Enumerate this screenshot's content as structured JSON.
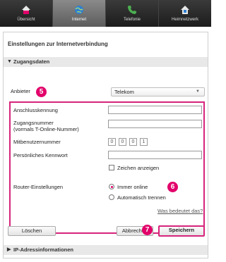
{
  "nav": {
    "tabs": [
      {
        "label": "Übersicht",
        "icon": "home-icon"
      },
      {
        "label": "Internet",
        "icon": "globe-icon"
      },
      {
        "label": "Telefonie",
        "icon": "phone-icon"
      },
      {
        "label": "Heimnetzwerk",
        "icon": "house-network-icon"
      }
    ],
    "active": "Internet"
  },
  "page": {
    "title": "Einstellungen zur Internetverbindung",
    "section_zugang": "Zugangsdaten",
    "section_ip": "IP-Adressinformationen"
  },
  "form": {
    "anbieter_label": "Anbieter",
    "anbieter_value": "Telekom",
    "anschluss_label": "Anschlusskennung",
    "zugangsnummer_label": "Zugangsnummer",
    "zugangsnummer_sub": "(vormals T-Online-Nummer)",
    "mitbenutzer_label": "Mitbenutzernummer",
    "mitbenutzer_digits": [
      "0",
      "0",
      "0",
      "1"
    ],
    "kennwort_label": "Persönliches Kennwort",
    "zeichen_label": "Zeichen anzeigen",
    "router_label": "Router-Einstellungen",
    "radio_immer": "Immer online",
    "radio_auto": "Automatisch trennen",
    "help_link": "Was bedeutet das?"
  },
  "buttons": {
    "loeschen": "Löschen",
    "abbrechen": "Abbrechen",
    "speichern": "Speichern"
  },
  "badges": {
    "b5": "5",
    "b6": "6",
    "b7": "7"
  },
  "colors": {
    "accent": "#e2006a",
    "highlight_border": "#d6247b"
  }
}
